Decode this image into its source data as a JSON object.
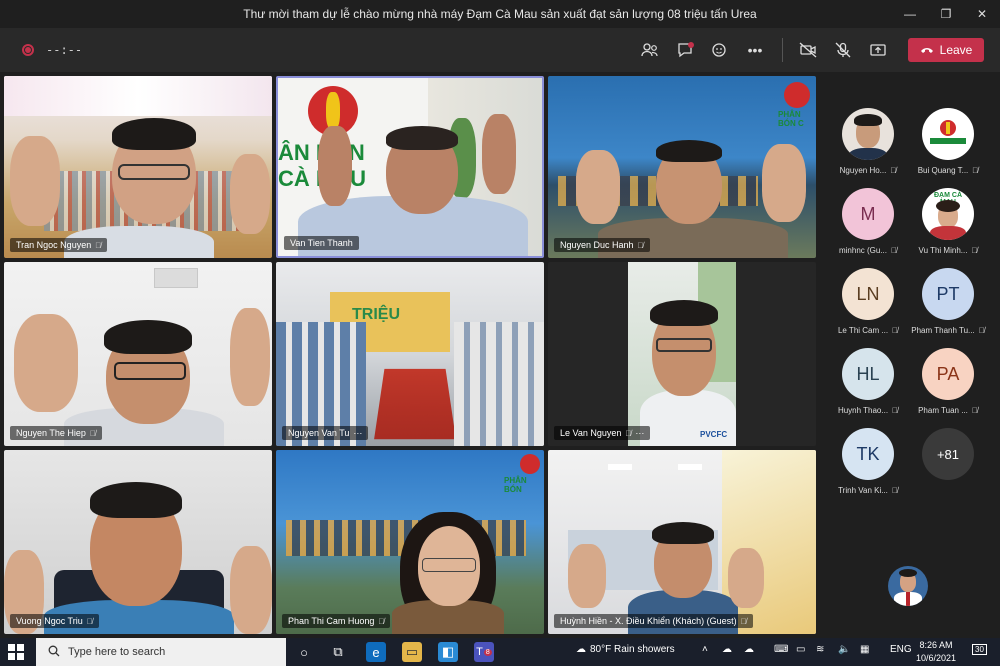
{
  "window": {
    "title": "Thư mời tham dự lễ chào mừng nhà máy Đạm Cà Mau sản xuất đạt sản lượng 08 triệu tấn Urea"
  },
  "toolbar": {
    "timer": "--:--",
    "leave_label": "Leave"
  },
  "tiles": [
    {
      "name": "Tran Ngoc Nguyen"
    },
    {
      "name": "Van Tien Thanh"
    },
    {
      "name": "Nguyen Duc Hanh"
    },
    {
      "name": "Nguyen The Hiep"
    },
    {
      "name": "Nguyen Van Tu"
    },
    {
      "name": "Le Van Nguyen"
    },
    {
      "name": "Vuong Ngoc Triu"
    },
    {
      "name": "Phan Thi Cam Huong"
    },
    {
      "name": "Huỳnh Hiền - X. Điều Khiển (Khách) (Guest)"
    }
  ],
  "roster": [
    {
      "name": "Nguyen Ho...",
      "initials": ""
    },
    {
      "name": "Bui Quang T...",
      "initials": ""
    },
    {
      "name": "minhnc (Gu...",
      "initials": "M"
    },
    {
      "name": "Vu Thi Minh...",
      "initials": ""
    },
    {
      "name": "Le Thi Cam ...",
      "initials": "LN"
    },
    {
      "name": "Pham Thanh Tu...",
      "initials": "PT"
    },
    {
      "name": "Huynh Thao...",
      "initials": "HL"
    },
    {
      "name": "Pham Tuan ...",
      "initials": "PA"
    },
    {
      "name": "Trinh Van Ki...",
      "initials": "TK"
    },
    {
      "name": "",
      "initials": "+81"
    }
  ],
  "taskbar": {
    "search_placeholder": "Type here to search",
    "weather": "80°F  Rain showers",
    "lang": "ENG",
    "time": "8:26 AM",
    "date": "10/6/2021",
    "notif_count": "30",
    "teams_badge": "8"
  },
  "colors": {
    "leave": "#c4314b",
    "bg": "#1f1f1f"
  }
}
